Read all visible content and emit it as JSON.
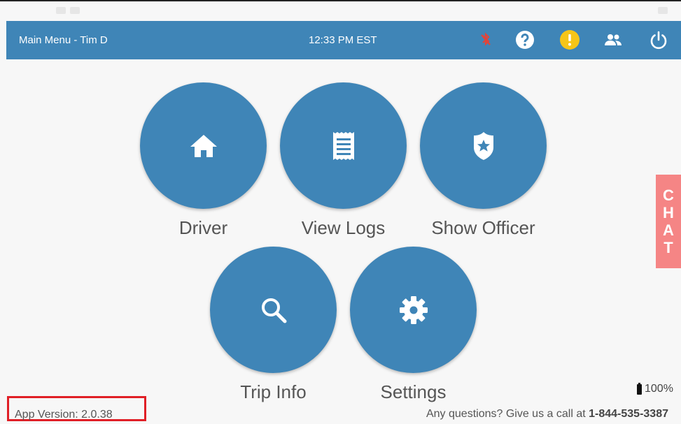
{
  "header": {
    "title": "Main Menu - Tim D",
    "time": "12:33 PM EST",
    "icons": [
      "bluetooth-disabled-icon",
      "help-icon",
      "alert-icon",
      "people-icon",
      "power-icon"
    ]
  },
  "tiles": [
    {
      "label": "Driver",
      "icon": "home-icon"
    },
    {
      "label": "View Logs",
      "icon": "logs-icon"
    },
    {
      "label": "Show Officer",
      "icon": "badge-icon"
    },
    {
      "label": "Trip Info",
      "icon": "search-icon"
    },
    {
      "label": "Settings",
      "icon": "gear-icon"
    }
  ],
  "chat": {
    "letters": [
      "C",
      "H",
      "A",
      "T"
    ]
  },
  "battery": {
    "level": "100%"
  },
  "footer": {
    "version": "App Version: 2.0.38",
    "contact_prefix": "Any questions? Give us a call at",
    "phone": "1-844-535-3387"
  },
  "colors": {
    "primary": "#3f85b7",
    "chat": "#f58585",
    "alert": "#f5c518",
    "bluetooth_off": "#e0453a",
    "highlight_border": "#e01f26"
  }
}
